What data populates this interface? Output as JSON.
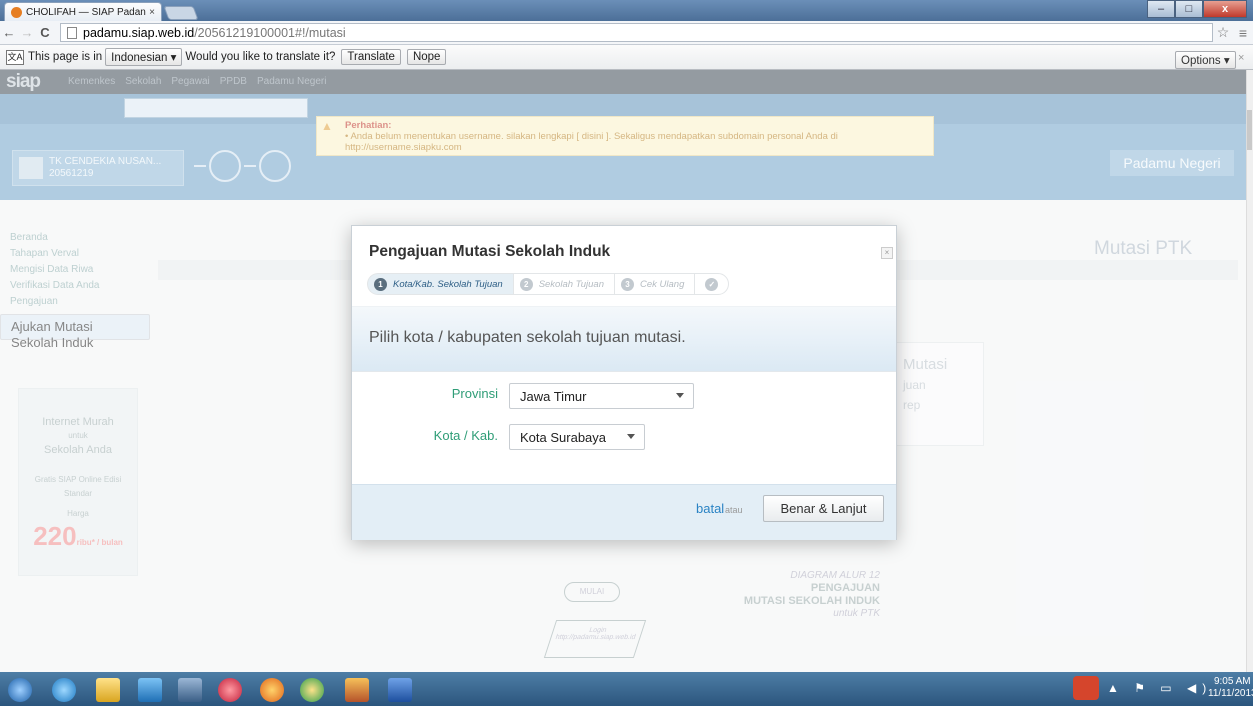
{
  "browser": {
    "tab_title": "CHOLIFAH — SIAP Padan",
    "tab_close": "×",
    "url_domain": "padamu.siap.web.id",
    "url_path": "/20561219100001#!/mutasi",
    "back": "←",
    "forward": "→",
    "reload": "C",
    "star": "☆",
    "menu": "≡",
    "win_min": "–",
    "win_max": "□",
    "win_close": "x"
  },
  "translate_bar": {
    "icon_text": "文A",
    "prefix": "This page is in",
    "language": "Indonesian ▾",
    "question": "Would you like to translate it?",
    "translate_btn": "Translate",
    "nope_btn": "Nope",
    "options_btn": "Options ▾",
    "close": "×"
  },
  "site": {
    "logo": "siap",
    "top_nav": [
      "Kemenkes",
      "Sekolah",
      "Pegawai",
      "PPDB",
      "Padamu Negeri"
    ],
    "notice_title": "Perhatian:",
    "notice_text": "• Anda belum menentukan username. silakan lengkapi [ disini ]. Sekaligus mendapatkan subdomain personal Anda di",
    "notice_link": "http://username.siapku.com",
    "school_name": "TK CENDEKIA NUSAN...",
    "school_code": "20561219",
    "padamu_negeri": "Padamu Negeri",
    "page_heading": "Mutasi PTK",
    "left_nav": [
      "Beranda",
      "Tahapan Verval",
      "Mengisi Data Riwa",
      "Verifikasi Data Anda",
      "Pengajuan",
      "Ajukan Mutasi Sekolah Induk"
    ],
    "promo": {
      "line1": "Internet Murah",
      "line2": "untuk",
      "line3": "Sekolah Anda",
      "line4": "Gratis SIAP Online Edisi Standar",
      "price_label": "Harga",
      "price": "220",
      "price_unit": "ribu* / bulan"
    },
    "bg_box_title": "Mutasi",
    "bg_box_line1": "juan",
    "bg_box_line2": "rep",
    "diagram": {
      "title_small": "DIAGRAM ALUR 12",
      "title1": "PENGAJUAN",
      "title2": "MUTASI SEKOLAH INDUK",
      "title3": "untuk PTK",
      "node_start": "MULAI",
      "node_login": "Login http://padamu.siap.web.id"
    }
  },
  "modal": {
    "title": "Pengajuan Mutasi Sekolah Induk",
    "close": "×",
    "steps": [
      {
        "num": "1",
        "label": "Kota/Kab. Sekolah Tujuan"
      },
      {
        "num": "2",
        "label": "Sekolah Tujuan"
      },
      {
        "num": "3",
        "label": "Cek Ulang"
      },
      {
        "num": "✓",
        "label": ""
      }
    ],
    "prompt": "Pilih kota / kabupaten sekolah tujuan mutasi.",
    "provinsi_label": "Provinsi",
    "provinsi_value": "Jawa Timur",
    "kota_label": "Kota / Kab.",
    "kota_value": "Kota Surabaya",
    "batal": "batal",
    "atau": "atau",
    "submit": "Benar & Lanjut"
  },
  "taskbar": {
    "time": "9:05 AM",
    "date": "11/11/2013",
    "tray": "▲ ⚑ ▭ ◀)"
  },
  "colors": {
    "accent": "#2f9d77",
    "link": "#2a83c4",
    "blue_header": "#6fa3c8"
  }
}
